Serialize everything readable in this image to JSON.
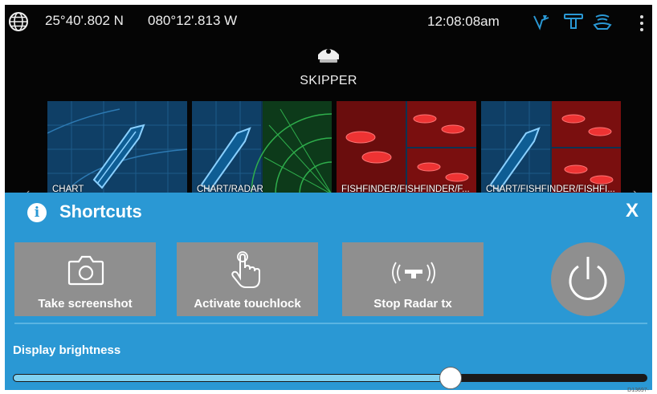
{
  "status_bar": {
    "latitude": "25°40'.802 N",
    "longitude": "080°12'.813 W",
    "time": "12:08:08am",
    "icons": [
      "gps-globe-icon",
      "chart-fix-icon",
      "radar-scanner-icon",
      "sonar-icon",
      "menu-kebab-icon"
    ]
  },
  "profile": {
    "icon": "captain-hat-icon",
    "name": "SKIPPER"
  },
  "apps": [
    {
      "label": "CHART"
    },
    {
      "label": "CHART/RADAR"
    },
    {
      "label": "FISHFINDER/FISHFINDER/F..."
    },
    {
      "label": "CHART/FISHFINDER/FISHFI..."
    }
  ],
  "shortcuts": {
    "title": "Shortcuts",
    "close_label": "X",
    "buttons": [
      {
        "label": "Take screenshot",
        "icon": "camera-icon"
      },
      {
        "label": "Activate touchlock",
        "icon": "touch-hand-icon"
      },
      {
        "label": "Stop Radar tx",
        "icon": "radar-transmit-icon"
      }
    ],
    "power_icon": "power-icon",
    "brightness": {
      "label": "Display brightness",
      "value_fraction": 0.69
    }
  },
  "doc_code": "D13697-",
  "colors": {
    "panel_bg": "#2a98d4",
    "button_bg": "#8f8f8f",
    "slider_fill": "#7fd1f0",
    "screen_bg": "#050505"
  }
}
